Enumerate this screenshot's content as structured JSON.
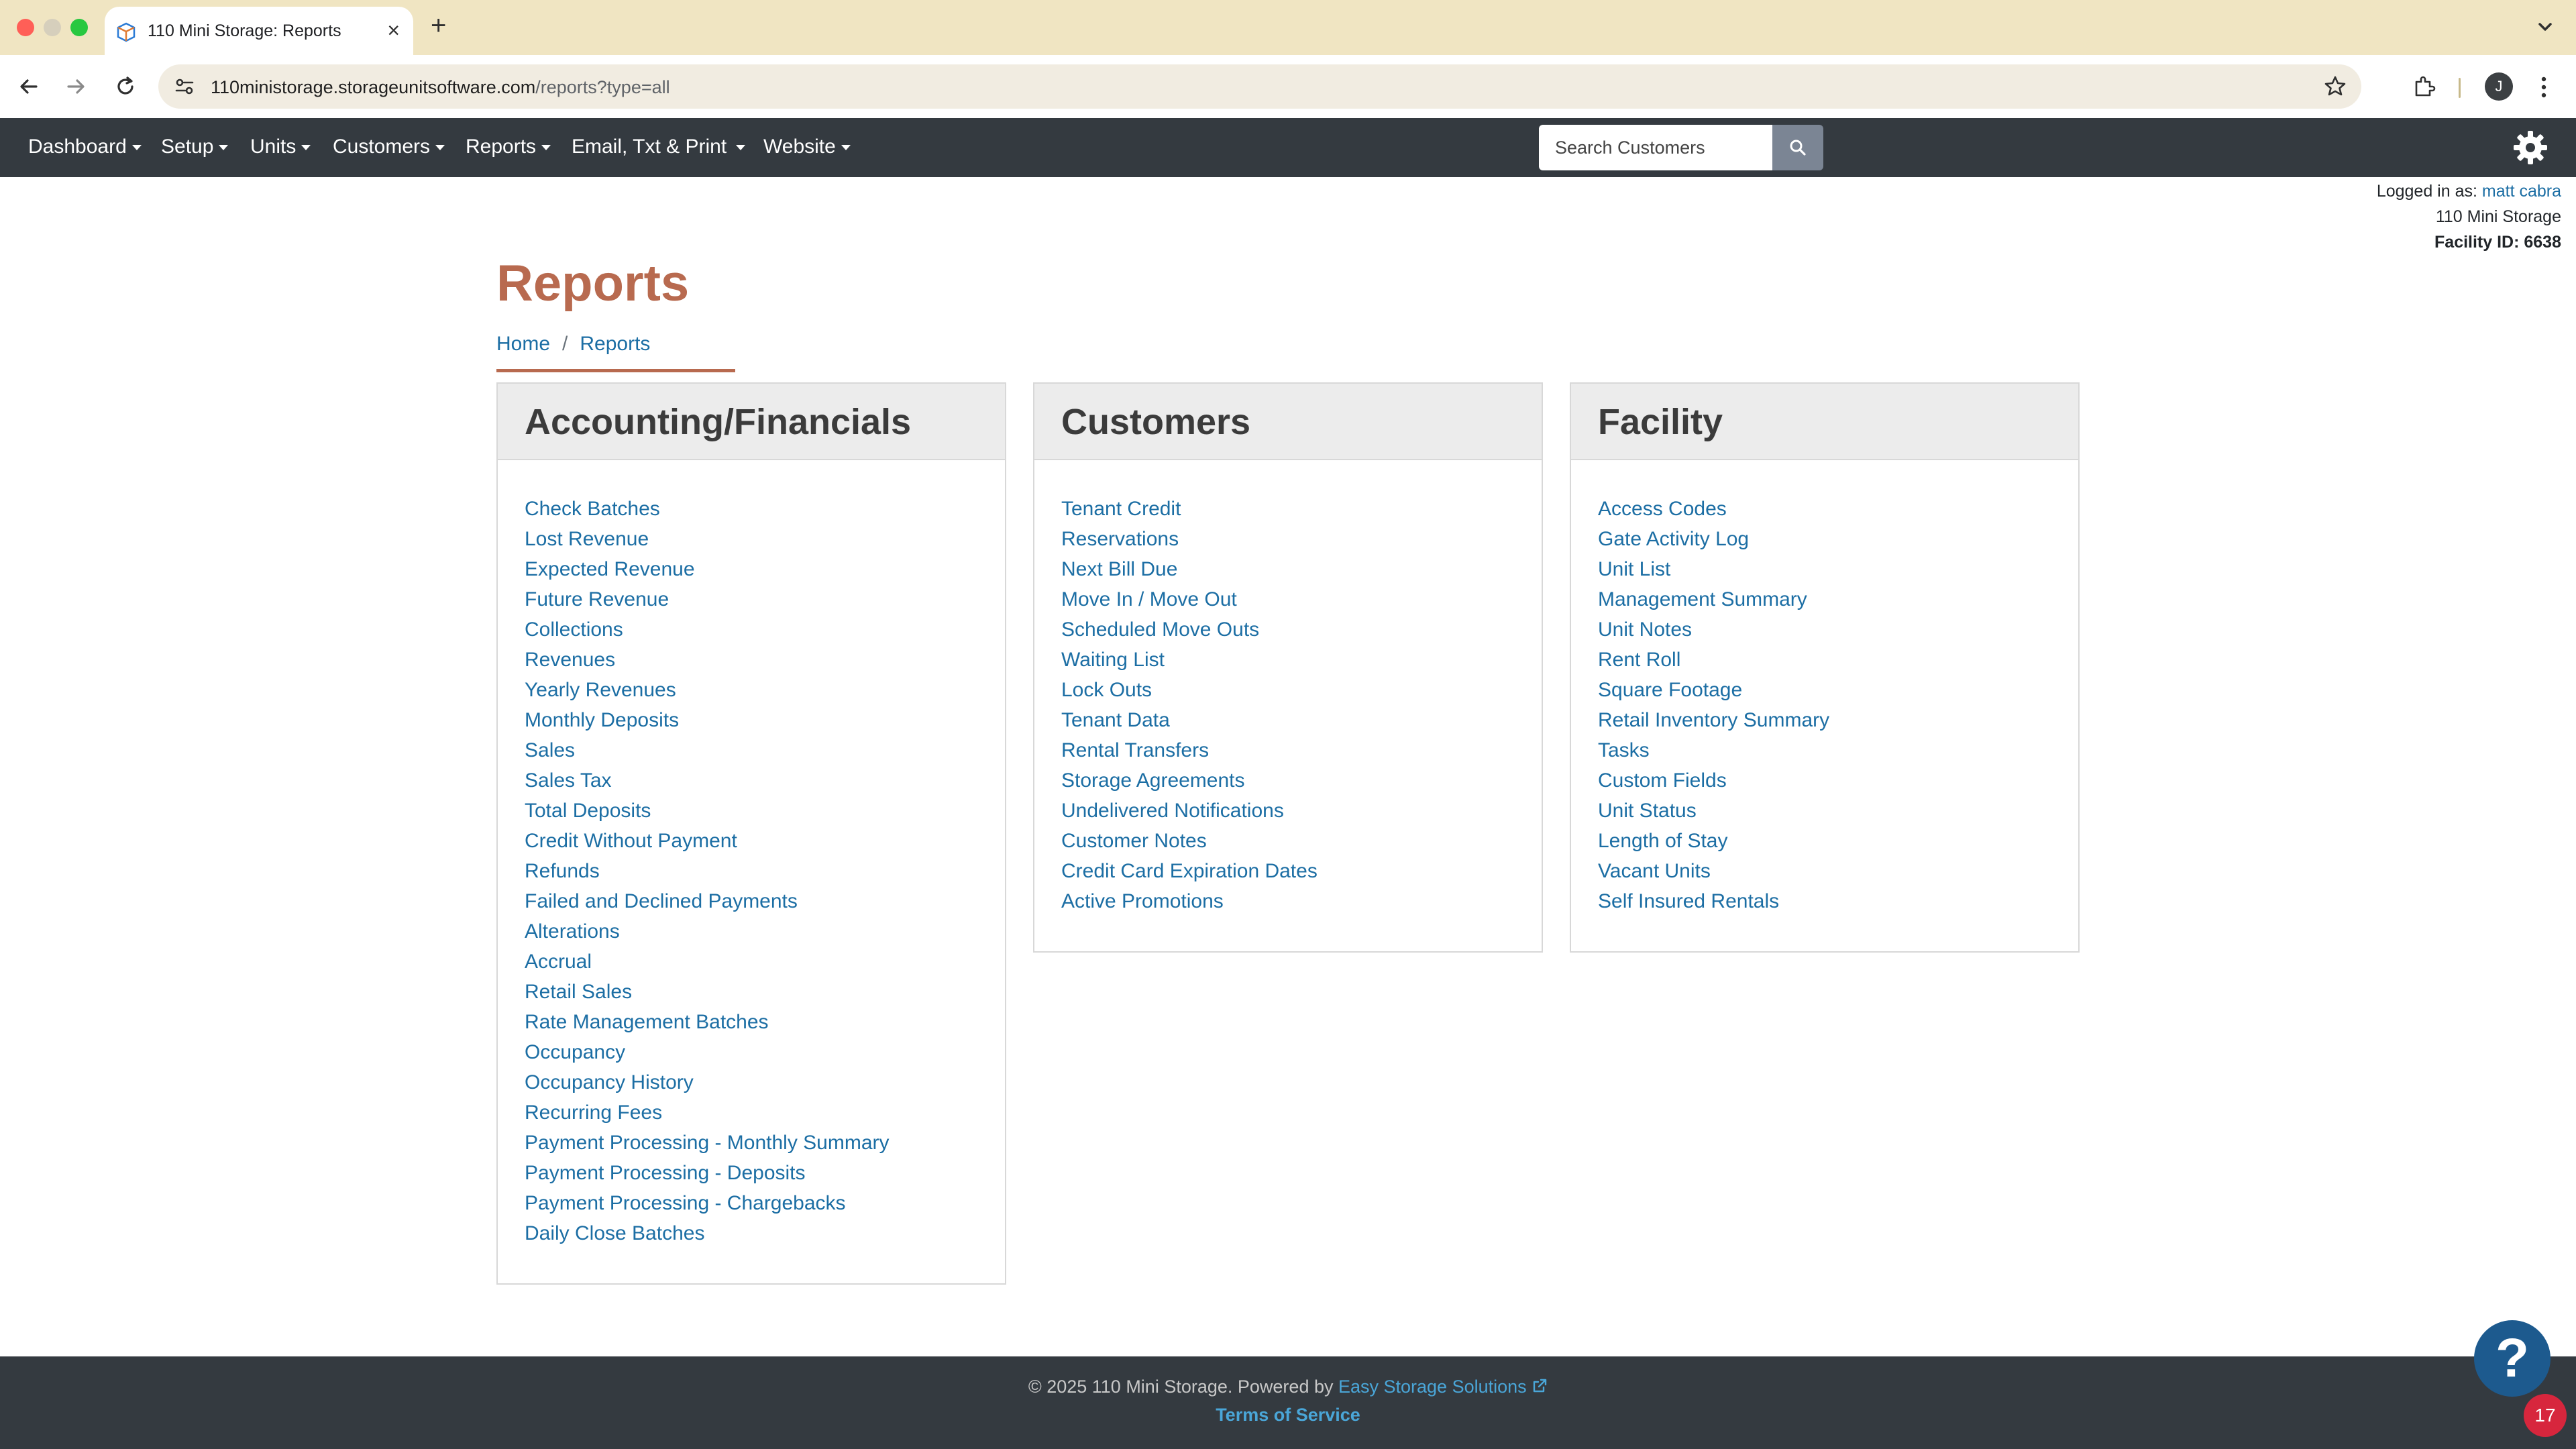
{
  "browser": {
    "tab_title": "110 Mini Storage: Reports",
    "url_domain": "110ministorage.storageunitsoftware.com",
    "url_path": "/reports?type=all",
    "profile_initial": "J"
  },
  "navbar": {
    "items": [
      {
        "label": "Dashboard"
      },
      {
        "label": "Setup"
      },
      {
        "label": "Units"
      },
      {
        "label": "Customers"
      },
      {
        "label": "Reports"
      },
      {
        "label": "Email, Txt & Print"
      },
      {
        "label": "Website"
      }
    ],
    "search_placeholder": "Search Customers"
  },
  "login": {
    "prefix": "Logged in as: ",
    "user": "matt cabra",
    "facility_name": "110 Mini Storage",
    "facility_id": "Facility ID: 6638"
  },
  "page": {
    "title": "Reports",
    "breadcrumb": [
      "Home",
      "Reports"
    ]
  },
  "sections": [
    {
      "title": "Accounting/Financials",
      "links": [
        "Check Batches",
        "Lost Revenue",
        "Expected Revenue",
        "Future Revenue",
        "Collections",
        "Revenues",
        "Yearly Revenues",
        "Monthly Deposits",
        "Sales",
        "Sales Tax",
        "Total Deposits",
        "Credit Without Payment",
        "Refunds",
        "Failed and Declined Payments",
        "Alterations",
        "Accrual",
        "Retail Sales",
        "Rate Management Batches",
        "Occupancy",
        "Occupancy History",
        "Recurring Fees",
        "Payment Processing - Monthly Summary",
        "Payment Processing - Deposits",
        "Payment Processing - Chargebacks",
        "Daily Close Batches"
      ]
    },
    {
      "title": "Customers",
      "links": [
        "Tenant Credit",
        "Reservations",
        "Next Bill Due",
        "Move In / Move Out",
        "Scheduled Move Outs",
        "Waiting List",
        "Lock Outs",
        "Tenant Data",
        "Rental Transfers",
        "Storage Agreements",
        "Undelivered Notifications",
        "Customer Notes",
        "Credit Card Expiration Dates",
        "Active Promotions"
      ]
    },
    {
      "title": "Facility",
      "links": [
        "Access Codes",
        "Gate Activity Log",
        "Unit List",
        "Management Summary",
        "Unit Notes",
        "Rent Roll",
        "Square Footage",
        "Retail Inventory Summary",
        "Tasks",
        "Custom Fields",
        "Unit Status",
        "Length of Stay",
        "Vacant Units",
        "Self Insured Rentals"
      ]
    }
  ],
  "footer": {
    "copyright_prefix": "© 2025 110 Mini Storage. Powered by ",
    "powered_by": "Easy Storage Solutions",
    "terms": "Terms of Service"
  },
  "help": {
    "symbol": "?",
    "badge_count": "17"
  },
  "colors": {
    "accent": "#b86a4f",
    "link": "#1c6ea4",
    "navbar": "#343a40"
  }
}
